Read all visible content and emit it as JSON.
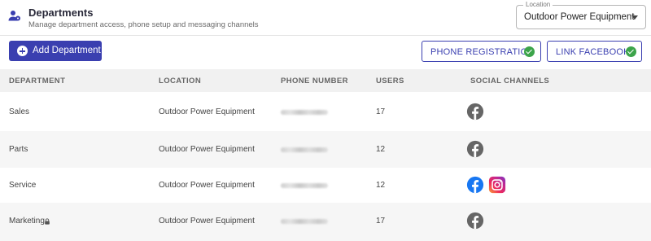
{
  "header": {
    "title": "Departments",
    "subtitle": "Manage department access, phone setup and messaging channels",
    "icon": "department-users-icon"
  },
  "location_select": {
    "label": "Location",
    "value": "Outdoor Power Equipment"
  },
  "toolbar": {
    "add_label": "Add Department",
    "phone_registration_label": "PHONE REGISTRATION",
    "link_facebook_label": "LINK FACEBOOK",
    "status_color": "#3ca44a",
    "accent": "#3a3fb0"
  },
  "table": {
    "columns": [
      "DEPARTMENT",
      "LOCATION",
      "PHONE NUMBER",
      "USERS",
      "SOCIAL CHANNELS"
    ],
    "rows": [
      {
        "department": "Sales",
        "location": "Outdoor Power Equipment",
        "phone": "(redacted)",
        "users": "17",
        "locked": false,
        "channels": [
          "facebook-gray"
        ]
      },
      {
        "department": "Parts",
        "location": "Outdoor Power Equipment",
        "phone": "(redacted)",
        "users": "12",
        "locked": false,
        "channels": [
          "facebook-gray"
        ]
      },
      {
        "department": "Service",
        "location": "Outdoor Power Equipment",
        "phone": "(redacted)",
        "users": "12",
        "locked": false,
        "channels": [
          "facebook-blue",
          "instagram"
        ]
      },
      {
        "department": "Marketing",
        "location": "Outdoor Power Equipment",
        "phone": "(redacted)",
        "users": "17",
        "locked": true,
        "channels": [
          "facebook-gray"
        ]
      }
    ]
  }
}
